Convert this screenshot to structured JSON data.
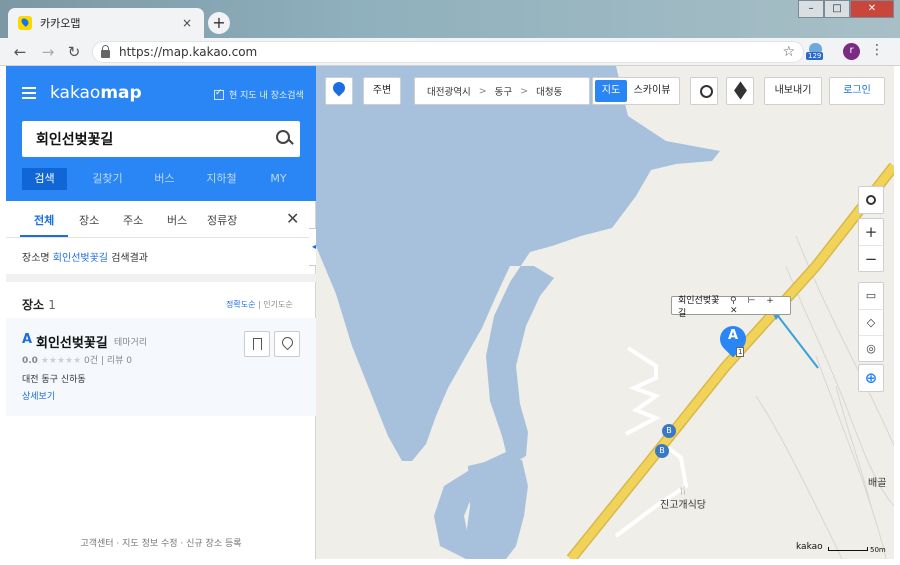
{
  "browser": {
    "tab_title": "카카오맵",
    "tab_close": "×",
    "new_tab": "+",
    "url": "https://map.kakao.com",
    "ext_badge": "129",
    "profile_initial": "r",
    "window_controls": {
      "minimize": "–",
      "maximize": "□",
      "close": "✕"
    },
    "nav": {
      "back": "←",
      "forward": "→",
      "reload": "↻"
    },
    "bookmark_star": "☆",
    "menu": "⋮"
  },
  "panel": {
    "logo_light": "kakao",
    "logo_bold": "map",
    "map_search_checkbox": "현 지도 내 장소검색",
    "search_value": "회인선벚꽃길",
    "modes": [
      "검색",
      "길찾기",
      "버스",
      "지하철",
      "MY"
    ],
    "subtabs": [
      "전체",
      "장소",
      "주소",
      "버스",
      "정류장"
    ],
    "close": "✕",
    "summary_prefix": "장소명",
    "summary_keyword": "회인선벚꽃길",
    "summary_suffix": "검색결과",
    "places_heading": "장소",
    "places_count": "1",
    "sort_active": "정확도순",
    "sort_sep": "|",
    "sort_other": "인기도순",
    "result": {
      "letter": "A",
      "name": "회인선벚꽃길",
      "category": "테마거리",
      "score": "0.0",
      "stars": "★★★★★",
      "reviews_count": "0건",
      "review_label": "리뷰 0",
      "address": "대전 동구 신하동",
      "detail_link": "상세보기"
    },
    "footer": "고객센터 · 지도 정보 수정 · 신규 장소 등록",
    "collapse": "◀"
  },
  "map": {
    "nearby": "주변",
    "breadcrumb": [
      "대전광역시",
      "동구",
      "대청동"
    ],
    "crumb_sep": ">",
    "map_type_active": "지도",
    "map_type_other": "스카이뷰",
    "export": "내보내기",
    "login": "로그인",
    "zoom_in": "+",
    "zoom_out": "−",
    "info_name": "회인선벚꽃길",
    "info_icons": "⚲ ⊢ + ✕",
    "marker_letter": "A",
    "restaurant": "진고개식당",
    "place_baegol": "배골",
    "road_num": "1",
    "bus_symbol": "B",
    "scale_brand": "kakao",
    "scale_label": "50m",
    "colors": {
      "water": "#a7c1dd",
      "land": "#efeee9",
      "road": "#f2d35a",
      "accent": "#2a85f5",
      "arrow": "#3aa0d8"
    }
  }
}
